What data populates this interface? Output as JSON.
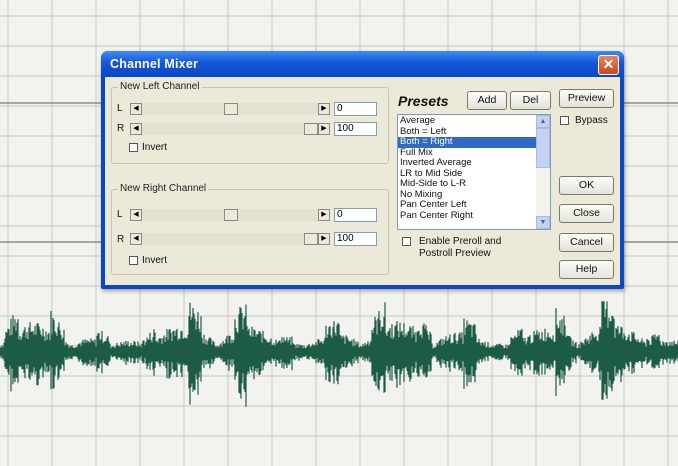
{
  "dialog": {
    "title": "Channel Mixer",
    "close_label": "✕"
  },
  "left_channel": {
    "group_label": "New Left Channel",
    "l_label": "L",
    "r_label": "R",
    "l_value": "0",
    "r_value": "100",
    "invert_label": "Invert",
    "l_slider_level": 0.5,
    "r_slider_level": 1.0
  },
  "right_channel": {
    "group_label": "New Right Channel",
    "l_label": "L",
    "r_label": "R",
    "l_value": "0",
    "r_value": "100",
    "invert_label": "Invert",
    "l_slider_level": 0.5,
    "r_slider_level": 1.0
  },
  "presets": {
    "title": "Presets",
    "add_label": "Add",
    "del_label": "Del",
    "items": [
      "Average",
      "Both = Left",
      "Both = Right",
      "Full Mix",
      "Inverted Average",
      "LR to Mid Side",
      "Mid-Side to L-R",
      "No Mixing",
      "Pan Center Left",
      "Pan Center Right"
    ],
    "selected": "Both = Right",
    "preroll_line1": "Enable Preroll and",
    "preroll_line2": "Postroll Preview"
  },
  "side_buttons": {
    "preview": "Preview",
    "bypass": "Bypass",
    "ok": "OK",
    "close": "Close",
    "cancel": "Cancel",
    "help": "Help"
  },
  "colors": {
    "title_bar": "#0a47c4",
    "waveform": "#1c5b45",
    "selection": "#316ac5"
  }
}
